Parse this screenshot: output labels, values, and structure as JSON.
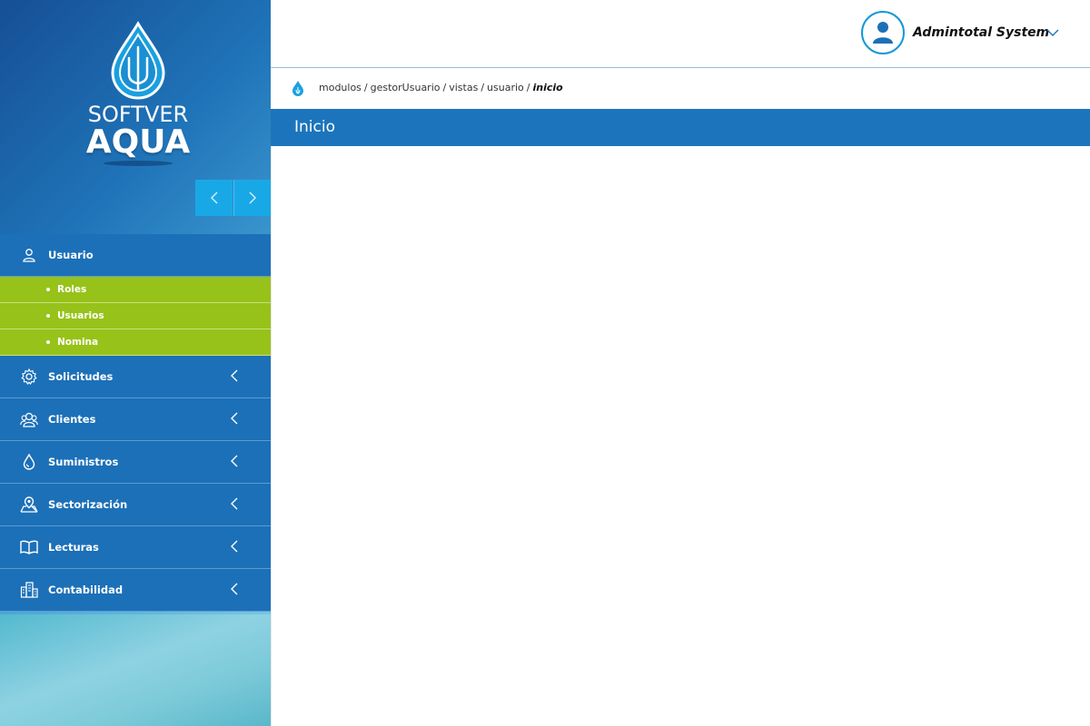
{
  "brand": {
    "line1": "SOFTVER",
    "line2": "AQUA"
  },
  "colors": {
    "primary": "#1c70b8",
    "submenu": "#97c21a",
    "accent": "#19a8e6",
    "title_bar": "#1c75bc"
  },
  "header": {
    "user_name": "Admintotal System",
    "avatar_icon": "user-icon",
    "dropdown_icon": "chevron-down-icon"
  },
  "breadcrumb": {
    "icon": "water-drop-icon",
    "items": [
      "modulos",
      "gestorUsuario",
      "vistas",
      "usuario"
    ],
    "separator": "/",
    "current": "inicio"
  },
  "page": {
    "title": "Inicio"
  },
  "sidebar": {
    "nav_prev_icon": "chevron-left-icon",
    "nav_next_icon": "chevron-right-icon",
    "usuario": {
      "label": "Usuario",
      "icon": "user-outline-icon"
    },
    "submenu": [
      {
        "label": "Roles"
      },
      {
        "label": "Usuarios"
      },
      {
        "label": "Nomina"
      }
    ],
    "items": [
      {
        "label": "Solicitudes",
        "icon": "gear-icon"
      },
      {
        "label": "Clientes",
        "icon": "group-icon"
      },
      {
        "label": "Suministros",
        "icon": "water-drop-icon"
      },
      {
        "label": "Sectorización",
        "icon": "map-pin-icon"
      },
      {
        "label": "Lecturas",
        "icon": "book-icon"
      },
      {
        "label": "Contabilidad",
        "icon": "building-icon"
      }
    ]
  }
}
